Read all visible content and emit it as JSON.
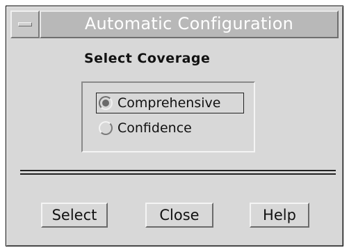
{
  "window": {
    "title": "Automatic Configuration",
    "menu_icon": "window-menu-icon"
  },
  "coverage": {
    "heading": "Select Coverage",
    "options": [
      {
        "label": "Comprehensive",
        "selected": true
      },
      {
        "label": "Confidence",
        "selected": false
      }
    ]
  },
  "buttons": {
    "select": "Select",
    "close": "Close",
    "help": "Help"
  }
}
